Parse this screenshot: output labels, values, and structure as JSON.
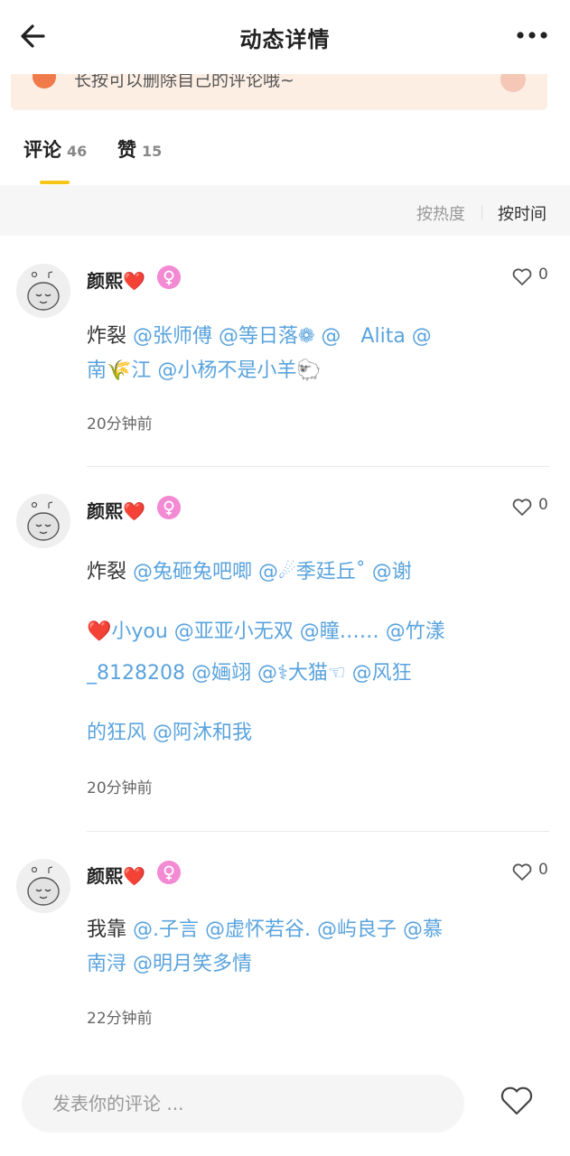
{
  "header": {
    "title": "动态详情"
  },
  "tip": {
    "text": "长按可以删除自己的评论哦~"
  },
  "tabs": [
    {
      "label": "评论",
      "count": "46"
    },
    {
      "label": "赞",
      "count": "15"
    }
  ],
  "sort": {
    "hot": "按热度",
    "time": "按时间"
  },
  "comments": [
    {
      "username": "颜熙❤️",
      "likes": "0",
      "prefix": "炸裂 ",
      "lines": [
        "@张师傅 @等日落❁ @　Alita @",
        "南🌾江 @小杨不是小羊🐑"
      ],
      "time": "20分钟前"
    },
    {
      "username": "颜熙❤️",
      "likes": "0",
      "prefix": "炸裂 ",
      "lines": [
        "@兔砸兔吧唧 @☄季廷丘˚ @谢",
        "❤️小you @亚亚小无双 @瞳…… @竹漾",
        "_8128208 @婳翊 @⚕大猫☜ @风狂",
        "的狂风 @阿沐和我"
      ],
      "time": "20分钟前"
    },
    {
      "username": "颜熙❤️",
      "likes": "0",
      "prefix": "我靠 ",
      "lines": [
        "@.子言 @虚怀若谷. @屿良子 @慕",
        "南浔 @明月笑多情"
      ],
      "time": "22分钟前"
    }
  ],
  "input": {
    "placeholder": "发表你的评论 ..."
  }
}
